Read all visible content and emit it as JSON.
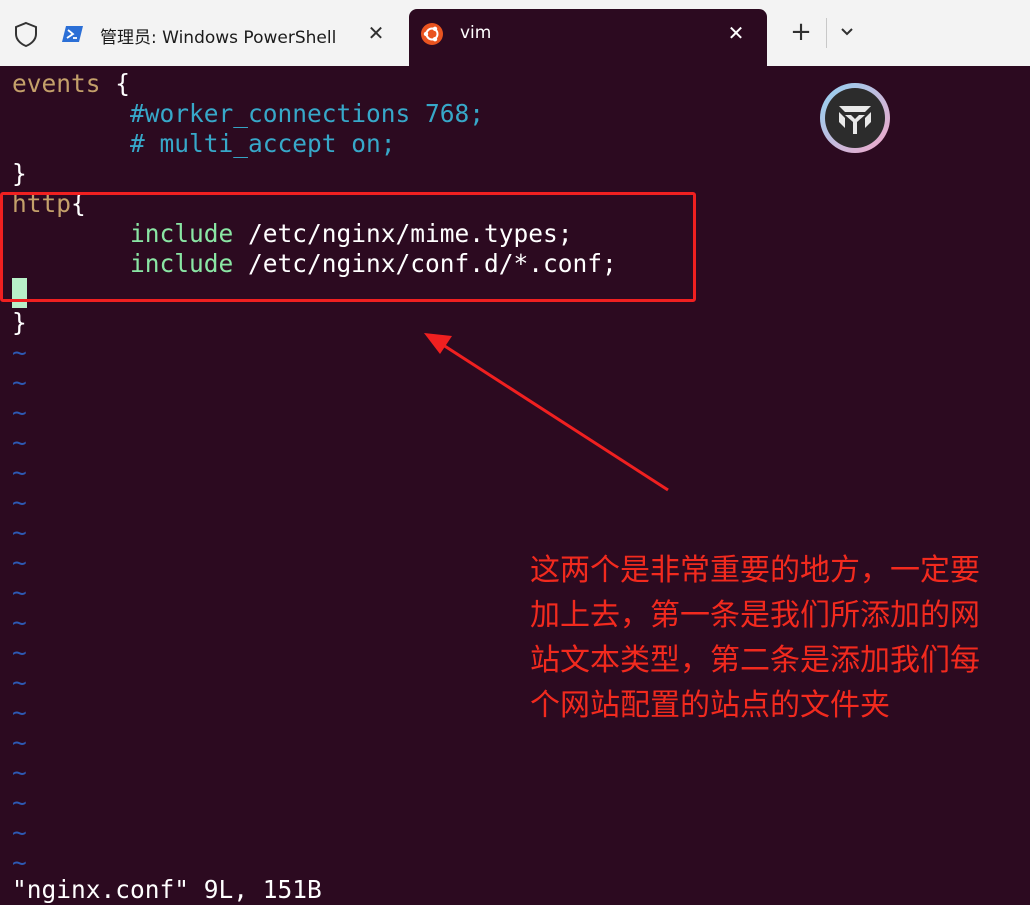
{
  "tabs": [
    {
      "label": "管理员: Windows PowerShell",
      "icon": "powershell-icon",
      "active": false
    },
    {
      "label": "vim",
      "icon": "ubuntu-icon",
      "active": true
    }
  ],
  "tab_close_glyph": "✕",
  "new_tab_glyph": "+",
  "code": {
    "line1": {
      "kw": "events",
      "rest": " {"
    },
    "line2": {
      "indent": "        ",
      "text": "#worker_connections 768;"
    },
    "line3": {
      "indent": "        ",
      "text": "# multi_accept on;"
    },
    "line4": "}",
    "line5": {
      "kw": "http",
      "rest": "{"
    },
    "line6": {
      "indent": "        ",
      "kw": "include",
      "rest": " /etc/nginx/mime.types;"
    },
    "line7": {
      "indent": "        ",
      "kw": "include",
      "rest": " /etc/nginx/conf.d/*.conf;"
    },
    "line9": "}"
  },
  "tilde": "~",
  "status_line": "\"nginx.conf\" 9L, 151B",
  "annotation": [
    "这两个是非常重要的地方，一定要",
    "加上去，第一条是我们所添加的网",
    "站文本类型，第二条是添加我们每",
    "个网站配置的站点的文件夹"
  ],
  "colors": {
    "terminal_bg": "#2c0a20",
    "annotation": "#f22a1e",
    "keyword_brown": "#c4a06a",
    "comment_teal": "#37a8c9",
    "include_green": "#8ae6a4",
    "tilde_blue": "#2d59b3"
  }
}
